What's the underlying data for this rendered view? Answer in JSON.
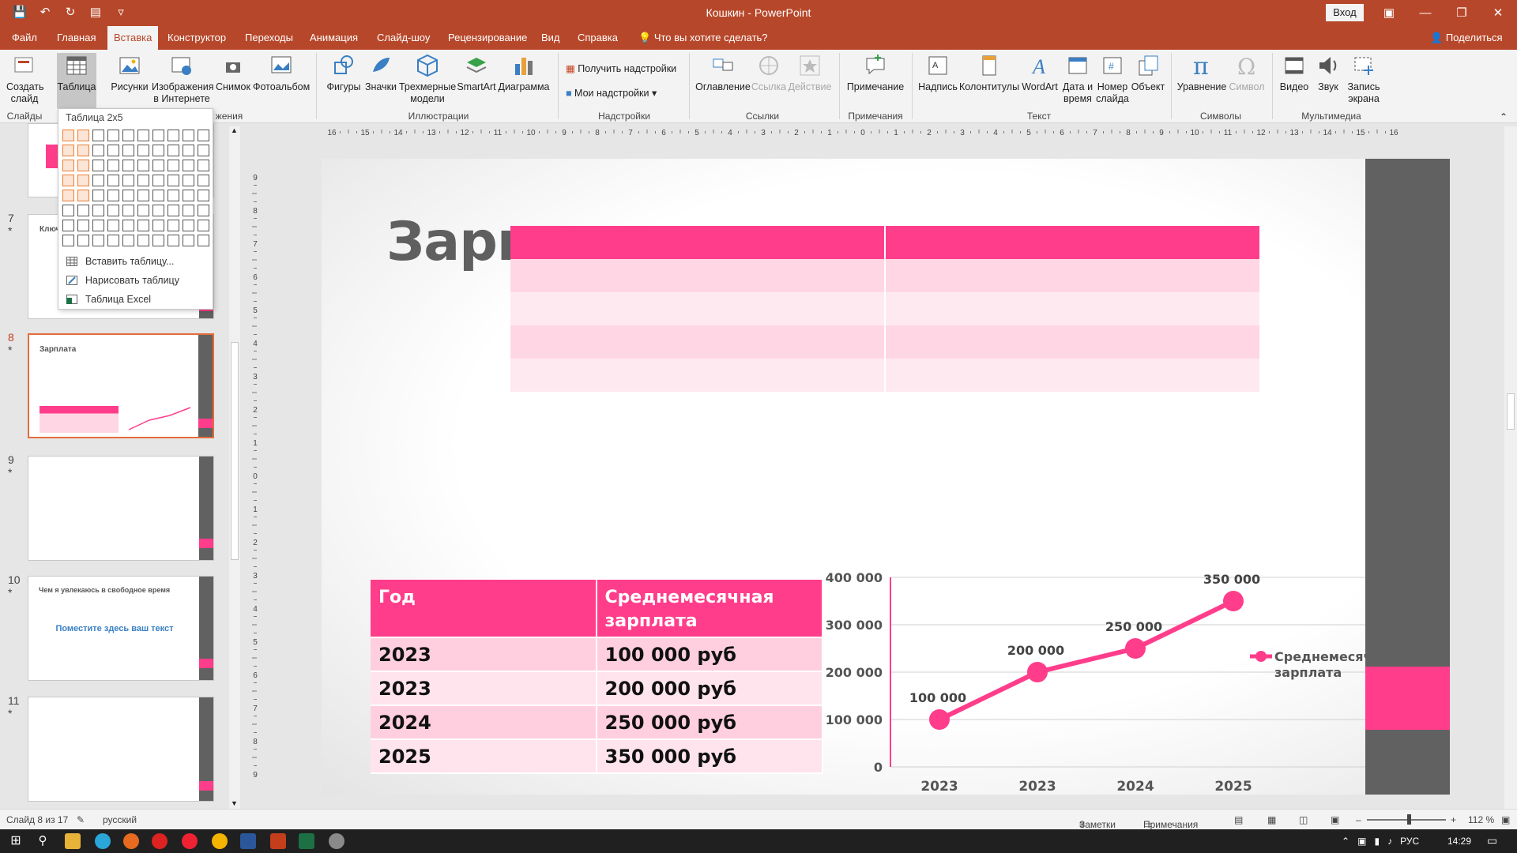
{
  "window": {
    "title": "Кошкин  -  PowerPoint",
    "login_label": "Вход",
    "share_label": "Поделиться",
    "tell_me": "Что вы хотите сделать?"
  },
  "tabs": [
    "Файл",
    "Главная",
    "Вставка",
    "Конструктор",
    "Переходы",
    "Анимация",
    "Слайд-шоу",
    "Рецензирование",
    "Вид",
    "Справка"
  ],
  "active_tab": "Вставка",
  "ribbon": {
    "new_slide": [
      "Создать",
      "слайд"
    ],
    "table": "Таблица",
    "pictures": "Рисунки",
    "online_pictures": [
      "Изображения",
      "в Интернете"
    ],
    "screenshot": "Снимок",
    "photo_album": "Фотоальбом",
    "shapes": "Фигуры",
    "icons": "Значки",
    "models_3d": [
      "Трехмерные",
      "модели"
    ],
    "smartart": "SmartArt",
    "chart": "Диаграмма",
    "get_addins": "Получить надстройки",
    "my_addins": "Мои надстройки",
    "zoom": "Оглавление",
    "link": "Ссылка",
    "action": "Действие",
    "comment": "Примечание",
    "textbox": "Надпись",
    "header_footer": "Колонтитулы",
    "wordart": "WordArt",
    "datetime": [
      "Дата и",
      "время"
    ],
    "slide_number": [
      "Номер",
      "слайда"
    ],
    "object": "Объект",
    "equation": "Уравнение",
    "symbol": "Символ",
    "video": "Видео",
    "audio": "Звук",
    "screen_recording": [
      "Запись",
      "экрана"
    ],
    "groups": {
      "slides": "Слайды",
      "images": "жения",
      "illustrations": "Иллюстрации",
      "addins": "Надстройки",
      "links": "Ссылки",
      "comments": "Примечания",
      "text": "Текст",
      "symbols": "Символы",
      "media": "Мультимедиа"
    }
  },
  "table_popup": {
    "title": "Таблица 2x5",
    "cols": 10,
    "rows": 8,
    "sel_cols": 2,
    "sel_rows": 5,
    "items": [
      "Вставить таблицу...",
      "Нарисовать таблицу",
      "Таблица Excel"
    ]
  },
  "ruler_h": [
    "16",
    "15",
    "14",
    "13",
    "12",
    "11",
    "10",
    "9",
    "8",
    "7",
    "6",
    "5",
    "4",
    "3",
    "2",
    "1",
    "0",
    "1",
    "2",
    "3",
    "4",
    "5",
    "6",
    "7",
    "8",
    "9",
    "10",
    "11",
    "12",
    "13",
    "14",
    "15",
    "16"
  ],
  "ruler_v": [
    "9",
    "8",
    "7",
    "6",
    "5",
    "4",
    "3",
    "2",
    "1",
    "0",
    "1",
    "2",
    "3",
    "4",
    "5",
    "6",
    "7",
    "8",
    "9"
  ],
  "thumbnails": [
    {
      "num": "7",
      "star": "*",
      "title": "Ключ"
    },
    {
      "num": "8",
      "star": "*",
      "title": "Зарплата",
      "current": true
    },
    {
      "num": "9",
      "star": "*",
      "title": ""
    },
    {
      "num": "10",
      "star": "*",
      "title": "Чем я увлекаюсь в свободное время",
      "body": "Поместите здесь ваш текст"
    },
    {
      "num": "11",
      "star": "*",
      "title": ""
    }
  ],
  "slide": {
    "title": "Зарпл",
    "empty_table_rows": 5,
    "data_table": {
      "headers": [
        "Год",
        "Среднемесячная зарплата"
      ],
      "rows": [
        [
          "2023",
          "100 000 руб"
        ],
        [
          "2023",
          "200 000 руб"
        ],
        [
          "2024",
          "250 000 руб"
        ],
        [
          "2025",
          "350 000 руб"
        ]
      ]
    }
  },
  "chart_data": {
    "type": "line",
    "categories": [
      "2023",
      "2023",
      "2024",
      "2025"
    ],
    "series": [
      {
        "name": "Среднемесячная зарплата",
        "values": [
          100000,
          200000,
          250000,
          350000
        ]
      }
    ],
    "data_labels": [
      "100 000",
      "200 000",
      "250 000",
      "350 000"
    ],
    "y_ticks": [
      "400 000",
      "300 000",
      "200 000",
      "100 000",
      "0"
    ],
    "ylim": [
      0,
      400000
    ],
    "grid": true,
    "legend": "right",
    "color": "#ff3d8b"
  },
  "status": {
    "slide_info": "Слайд 8 из 17",
    "language": "русский",
    "notes": "Заметки",
    "comments": "Примечания",
    "zoom": "112 %"
  },
  "taskbar": {
    "lang": "РУС",
    "time": "14:29"
  },
  "colors": {
    "accent": "#b7472a",
    "pink": "#ff3d8b",
    "gray_band": "#616161"
  }
}
